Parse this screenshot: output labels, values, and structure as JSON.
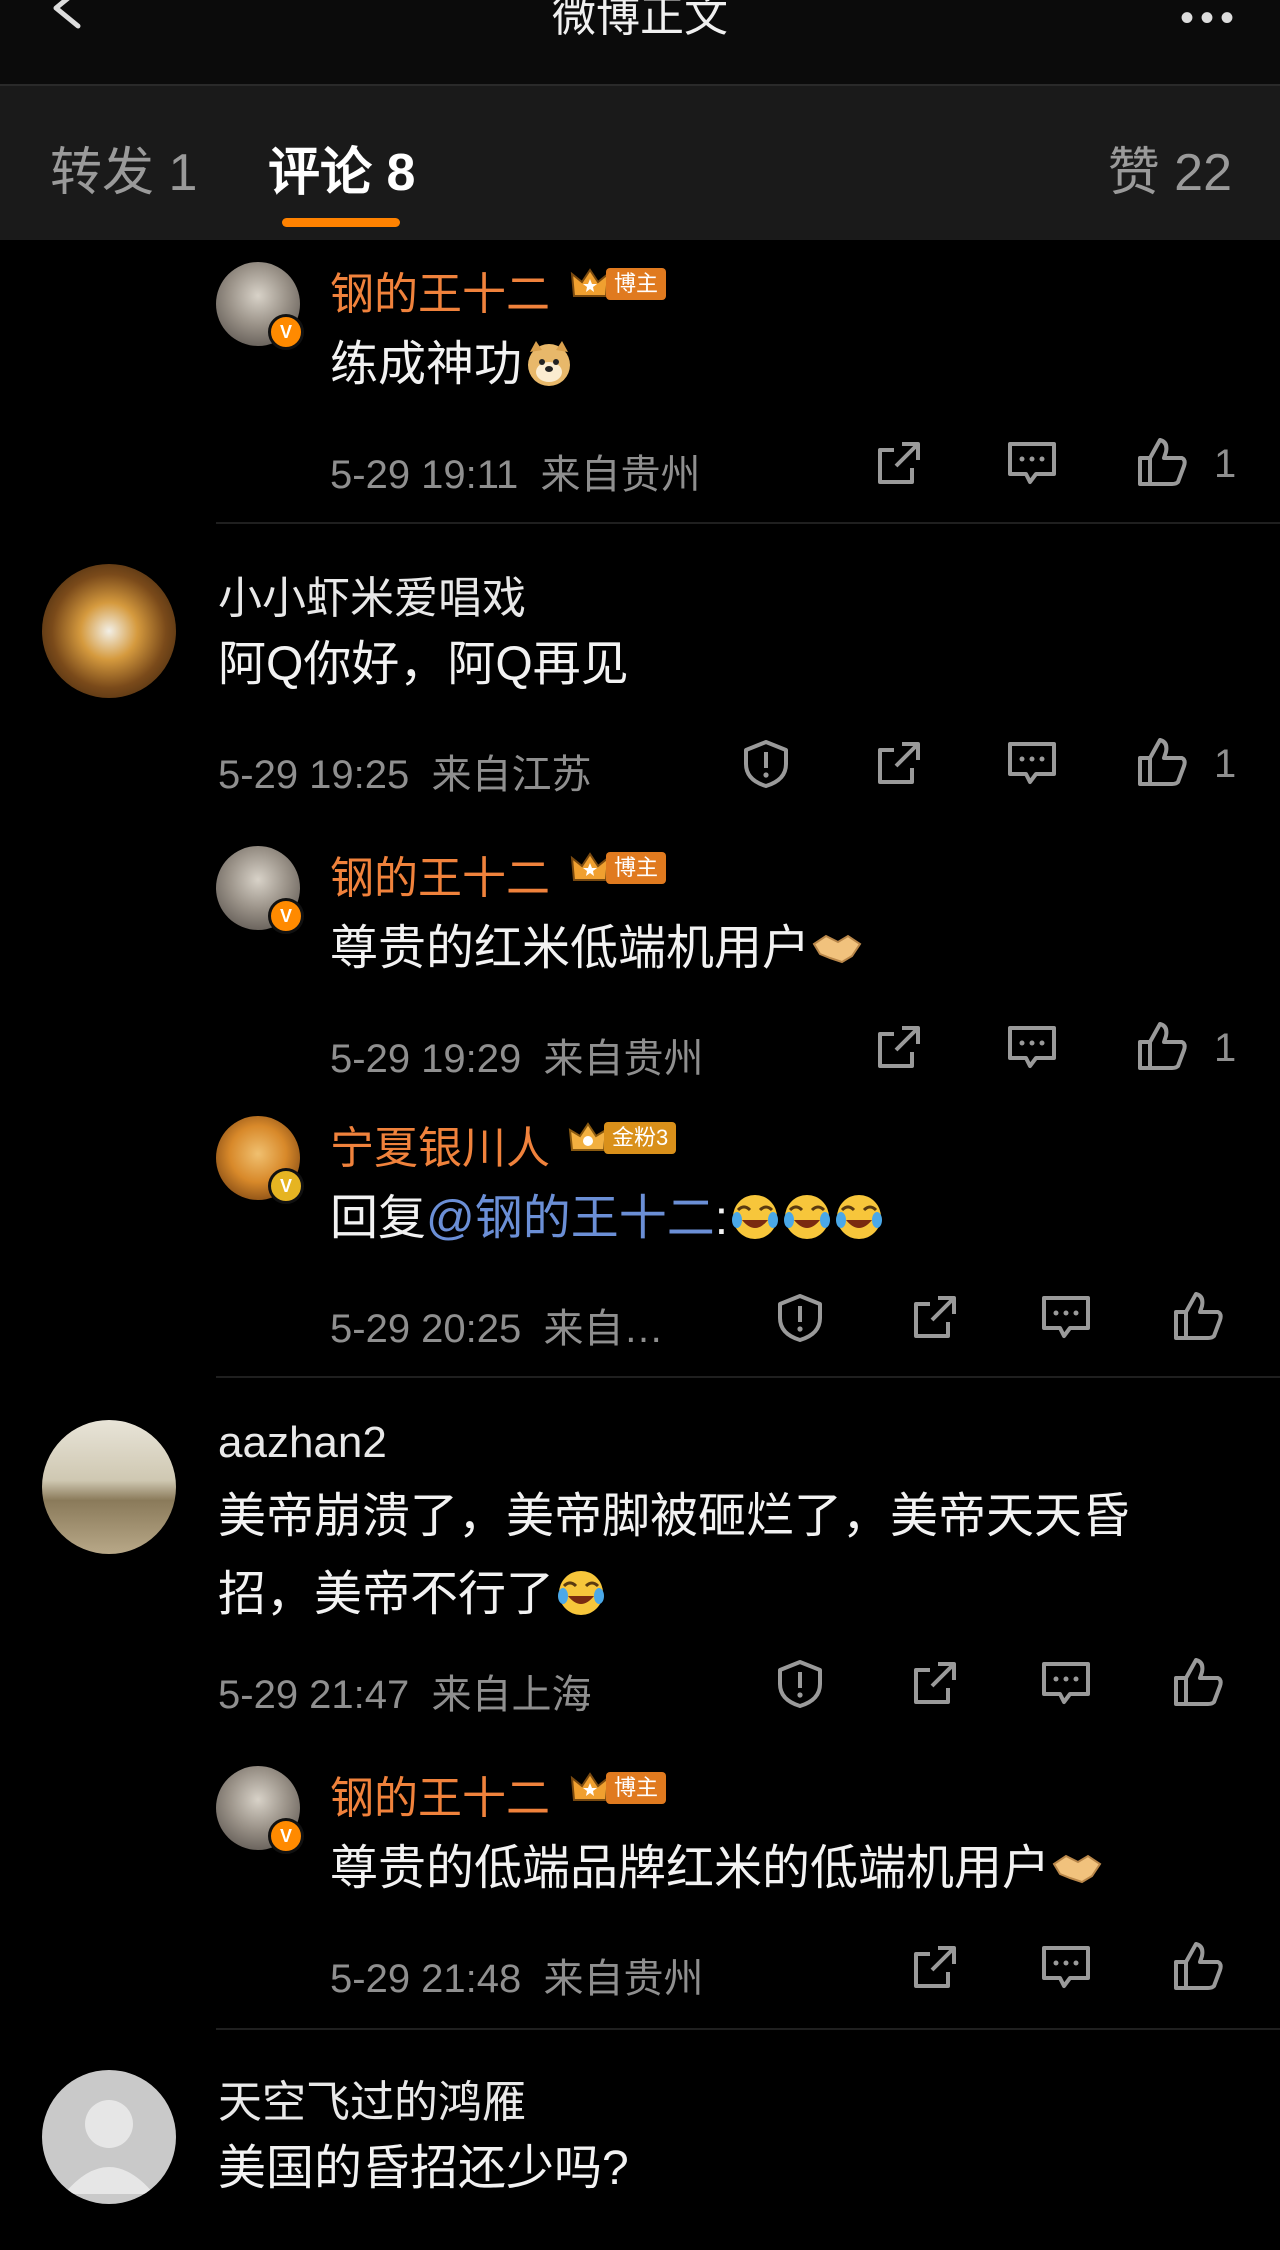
{
  "nav": {
    "title": "微博正文"
  },
  "tabs": {
    "repost": "转发 1",
    "comment": "评论 8",
    "like": "赞 22"
  },
  "comments": [
    {
      "name": "钢的王十二",
      "badge": "博主",
      "text": "练成神功",
      "time": "5-29 19:11",
      "location": "来自贵州",
      "likes": "1"
    },
    {
      "name": "小小虾米爱唱戏",
      "text": "阿Q你好，阿Q再见",
      "time": "5-29 19:25",
      "location": "来自江苏",
      "likes": "1"
    },
    {
      "name": "钢的王十二",
      "badge": "博主",
      "text": "尊贵的红米低端机用户",
      "time": "5-29 19:29",
      "location": "来自贵州",
      "likes": "1"
    },
    {
      "name": "宁夏银川人",
      "badge": "金粉3",
      "text_prefix": "回复",
      "mention": "@钢的王十二",
      "text_suffix": ":",
      "time": "5-29 20:25",
      "location": "来自…"
    },
    {
      "name": "aazhan2",
      "text_line1": "美帝崩溃了，美帝脚被砸烂了，美帝天天昏",
      "text_line2": "招，美帝不行了",
      "time": "5-29 21:47",
      "location": "来自上海"
    },
    {
      "name": "钢的王十二",
      "badge": "博主",
      "text": "尊贵的低端品牌红米的低端机用户",
      "time": "5-29 21:48",
      "location": "来自贵州"
    },
    {
      "name": "天空飞过的鸿雁",
      "text": "美国的昏招还少吗?"
    }
  ],
  "colors": {
    "accent": "#ff8200",
    "username": "#f0823c",
    "mention": "#6b8fd6",
    "background": "#000000"
  }
}
